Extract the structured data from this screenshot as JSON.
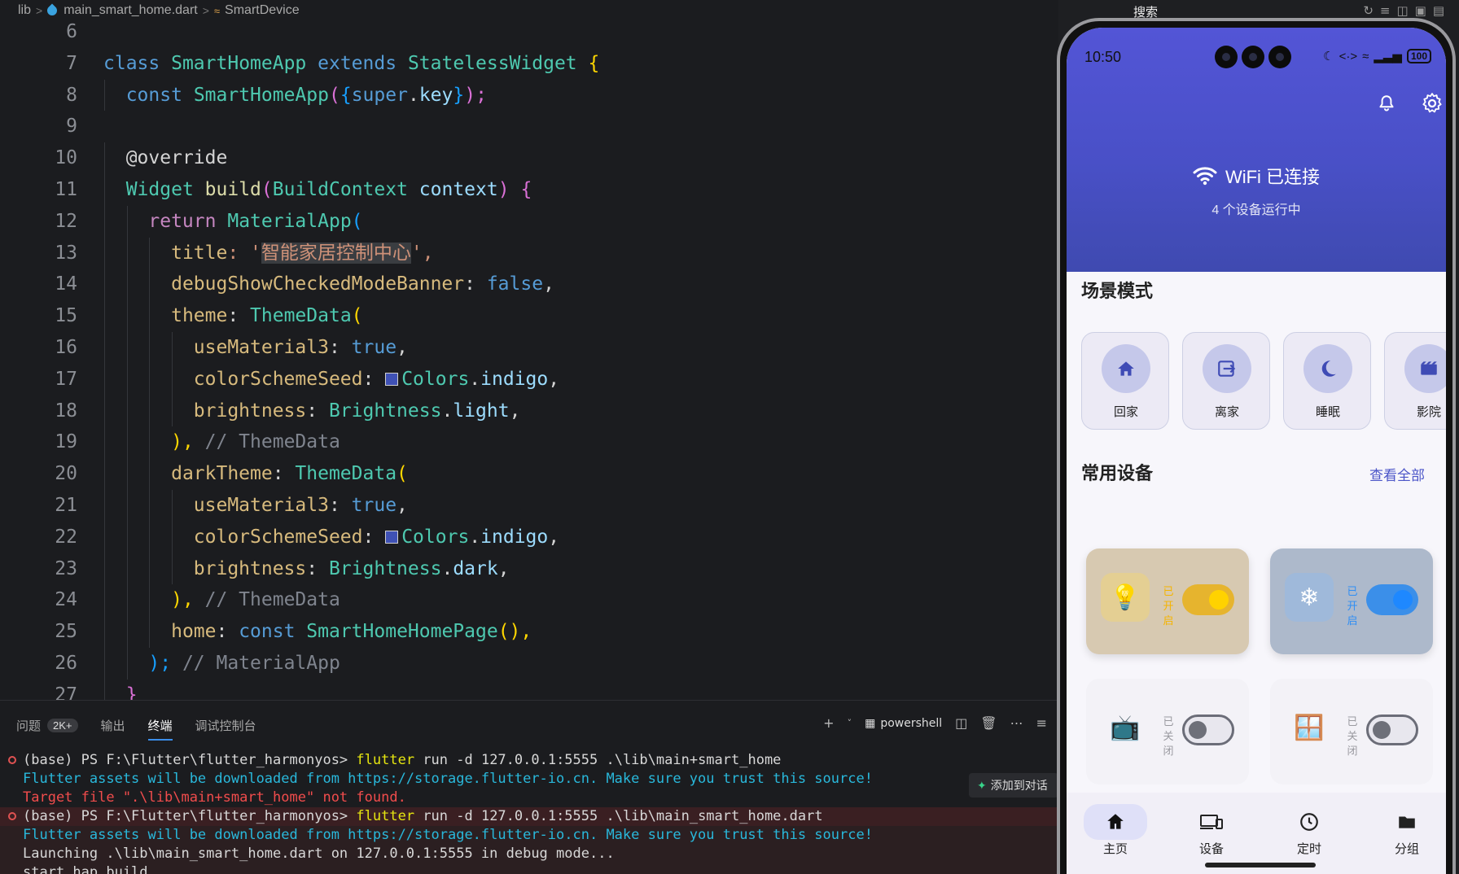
{
  "breadcrumb": {
    "folder": "lib",
    "file": "main_smart_home.dart",
    "symbol": "SmartDevice"
  },
  "editor": {
    "lines": [
      {
        "n": "6"
      },
      {
        "n": "7"
      },
      {
        "n": "8"
      },
      {
        "n": "9"
      },
      {
        "n": "10"
      },
      {
        "n": "11"
      },
      {
        "n": "12"
      },
      {
        "n": "13"
      },
      {
        "n": "14"
      },
      {
        "n": "15"
      },
      {
        "n": "16"
      },
      {
        "n": "17"
      },
      {
        "n": "18"
      },
      {
        "n": "19"
      },
      {
        "n": "20"
      },
      {
        "n": "21"
      },
      {
        "n": "22"
      },
      {
        "n": "23"
      },
      {
        "n": "24"
      },
      {
        "n": "25"
      },
      {
        "n": "26"
      },
      {
        "n": "27"
      }
    ],
    "code": {
      "l7": [
        "class",
        "SmartHomeApp",
        "extends",
        "StatelessWidget",
        "{"
      ],
      "l8": [
        "const",
        "SmartHomeApp",
        "(",
        "{",
        "super",
        ".",
        "key",
        "}",
        ");"
      ],
      "l10": "@override",
      "l11": [
        "Widget",
        "build",
        "(",
        "BuildContext",
        "context",
        ")",
        "{"
      ],
      "l12": [
        "return",
        "MaterialApp",
        "("
      ],
      "l13": [
        "title",
        ": '",
        "智能家居控制中心",
        "',"
      ],
      "l14": [
        "debugShowCheckedModeBanner",
        ": ",
        "false",
        ","
      ],
      "l15": [
        "theme",
        ": ",
        "ThemeData",
        "("
      ],
      "l16": [
        "useMaterial3",
        ": ",
        "true",
        ","
      ],
      "l17": [
        "colorSchemeSeed",
        ": ",
        "Colors",
        ".",
        "indigo",
        ","
      ],
      "l18": [
        "brightness",
        ": ",
        "Brightness",
        ".",
        "light",
        ","
      ],
      "l19": [
        "),",
        " // ThemeData"
      ],
      "l20": [
        "darkTheme",
        ": ",
        "ThemeData",
        "("
      ],
      "l21": [
        "useMaterial3",
        ": ",
        "true",
        ","
      ],
      "l22": [
        "colorSchemeSeed",
        ": ",
        "Colors",
        ".",
        "indigo",
        ","
      ],
      "l23": [
        "brightness",
        ": ",
        "Brightness",
        ".",
        "dark",
        ","
      ],
      "l24": [
        "),",
        " // ThemeData"
      ],
      "l25": [
        "home",
        ": ",
        "const",
        "SmartHomeHomePage",
        "(),"
      ],
      "l26": [
        ");",
        " // MaterialApp"
      ],
      "l27": "}"
    }
  },
  "panel": {
    "tabs": [
      {
        "label": "问题",
        "badge": "2K+"
      },
      {
        "label": "输出"
      },
      {
        "label": "终端"
      },
      {
        "label": "调试控制台"
      }
    ],
    "shell": "powershell",
    "add_chat": "添加到对话",
    "terminal": [
      {
        "prompt": "(base) PS F:\\Flutter\\flutter_harmonyos>",
        "cmd": "flutter",
        "args": " run -d 127.0.0.1:5555 .\\lib\\main+smart_home"
      },
      {
        "text": "Flutter assets will be downloaded from https://storage.flutter-io.cn. Make sure you trust this source!"
      },
      {
        "text": "Target file \".\\lib\\main+smart_home\" not found."
      },
      {
        "prompt": "(base) PS F:\\Flutter\\flutter_harmonyos>",
        "cmd": "flutter",
        "args": " run -d 127.0.0.1:5555 .\\lib\\main_smart_home.dart"
      },
      {
        "text": "Flutter assets will be downloaded from https://storage.flutter-io.cn. Make sure you trust this source!"
      },
      {
        "text": "Launching .\\lib\\main_smart_home.dart on 127.0.0.1:5555 in debug mode..."
      },
      {
        "text": "start hap build..."
      }
    ]
  },
  "right_strip": {
    "label": "搜索"
  },
  "phone": {
    "time": "10:50",
    "battery": "100",
    "wifi_title": "WiFi 已连接",
    "wifi_sub": "4 个设备运行中",
    "scene_title": "场景模式",
    "scenes": [
      {
        "label": "回家",
        "icon": "home-icon"
      },
      {
        "label": "离家",
        "icon": "exit-icon"
      },
      {
        "label": "睡眠",
        "icon": "moon-icon"
      },
      {
        "label": "影院",
        "icon": "movie-icon"
      }
    ],
    "devices_title": "常用设备",
    "see_all": "查看全部",
    "devices": [
      {
        "icon": "lightbulb-icon",
        "status": "已开启",
        "on": true,
        "color": "#f5b400"
      },
      {
        "icon": "snowflake-icon",
        "status": "已开启",
        "on": true,
        "color": "#2f8ef4"
      },
      {
        "icon": "tv-icon",
        "status": "已关闭",
        "on": false
      },
      {
        "icon": "window-icon",
        "status": "已关闭",
        "on": false
      }
    ],
    "nav": [
      {
        "label": "主页",
        "icon": "home-icon",
        "active": true
      },
      {
        "label": "设备",
        "icon": "devices-icon"
      },
      {
        "label": "定时",
        "icon": "clock-icon"
      },
      {
        "label": "分组",
        "icon": "folder-icon"
      }
    ]
  }
}
